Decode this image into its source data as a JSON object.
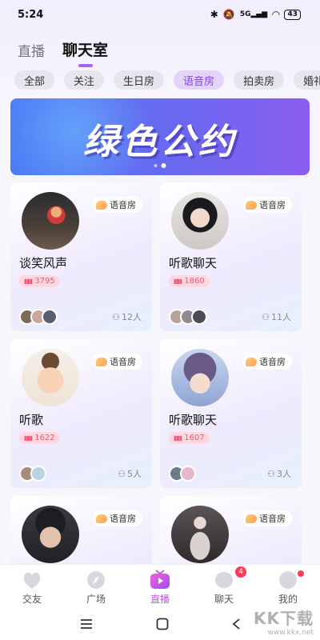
{
  "status_bar": {
    "time": "5:24",
    "net": "5G",
    "battery": "43"
  },
  "top_tabs": [
    {
      "label": "直播"
    },
    {
      "label": "聊天室"
    }
  ],
  "chips": [
    {
      "label": "全部"
    },
    {
      "label": "关注"
    },
    {
      "label": "生日房"
    },
    {
      "label": "语音房"
    },
    {
      "label": "拍卖房"
    },
    {
      "label": "婚礼"
    }
  ],
  "banner": {
    "title": "绿色公约"
  },
  "room_type": "语音房",
  "rooms": [
    {
      "name": "谈笑风声",
      "heat": "3795",
      "members": "12人"
    },
    {
      "name": "听歌聊天",
      "heat": "1860",
      "members": "11人"
    },
    {
      "name": "听歌",
      "heat": "1622",
      "members": "5人"
    },
    {
      "name": "听歌聊天",
      "heat": "1607",
      "members": "3人"
    },
    {
      "name": "",
      "heat": "",
      "members": ""
    },
    {
      "name": "",
      "heat": "",
      "members": ""
    }
  ],
  "bottom_nav": [
    {
      "label": "交友"
    },
    {
      "label": "广场"
    },
    {
      "label": "直播"
    },
    {
      "label": "聊天",
      "badge": "4"
    },
    {
      "label": "我的"
    }
  ],
  "watermark": {
    "big": "KK下载",
    "small": "www.kkx.net"
  },
  "colors": {
    "accent": "#a463f2",
    "badge_red": "#ff3b57",
    "heat_pink": "#f0567a"
  }
}
